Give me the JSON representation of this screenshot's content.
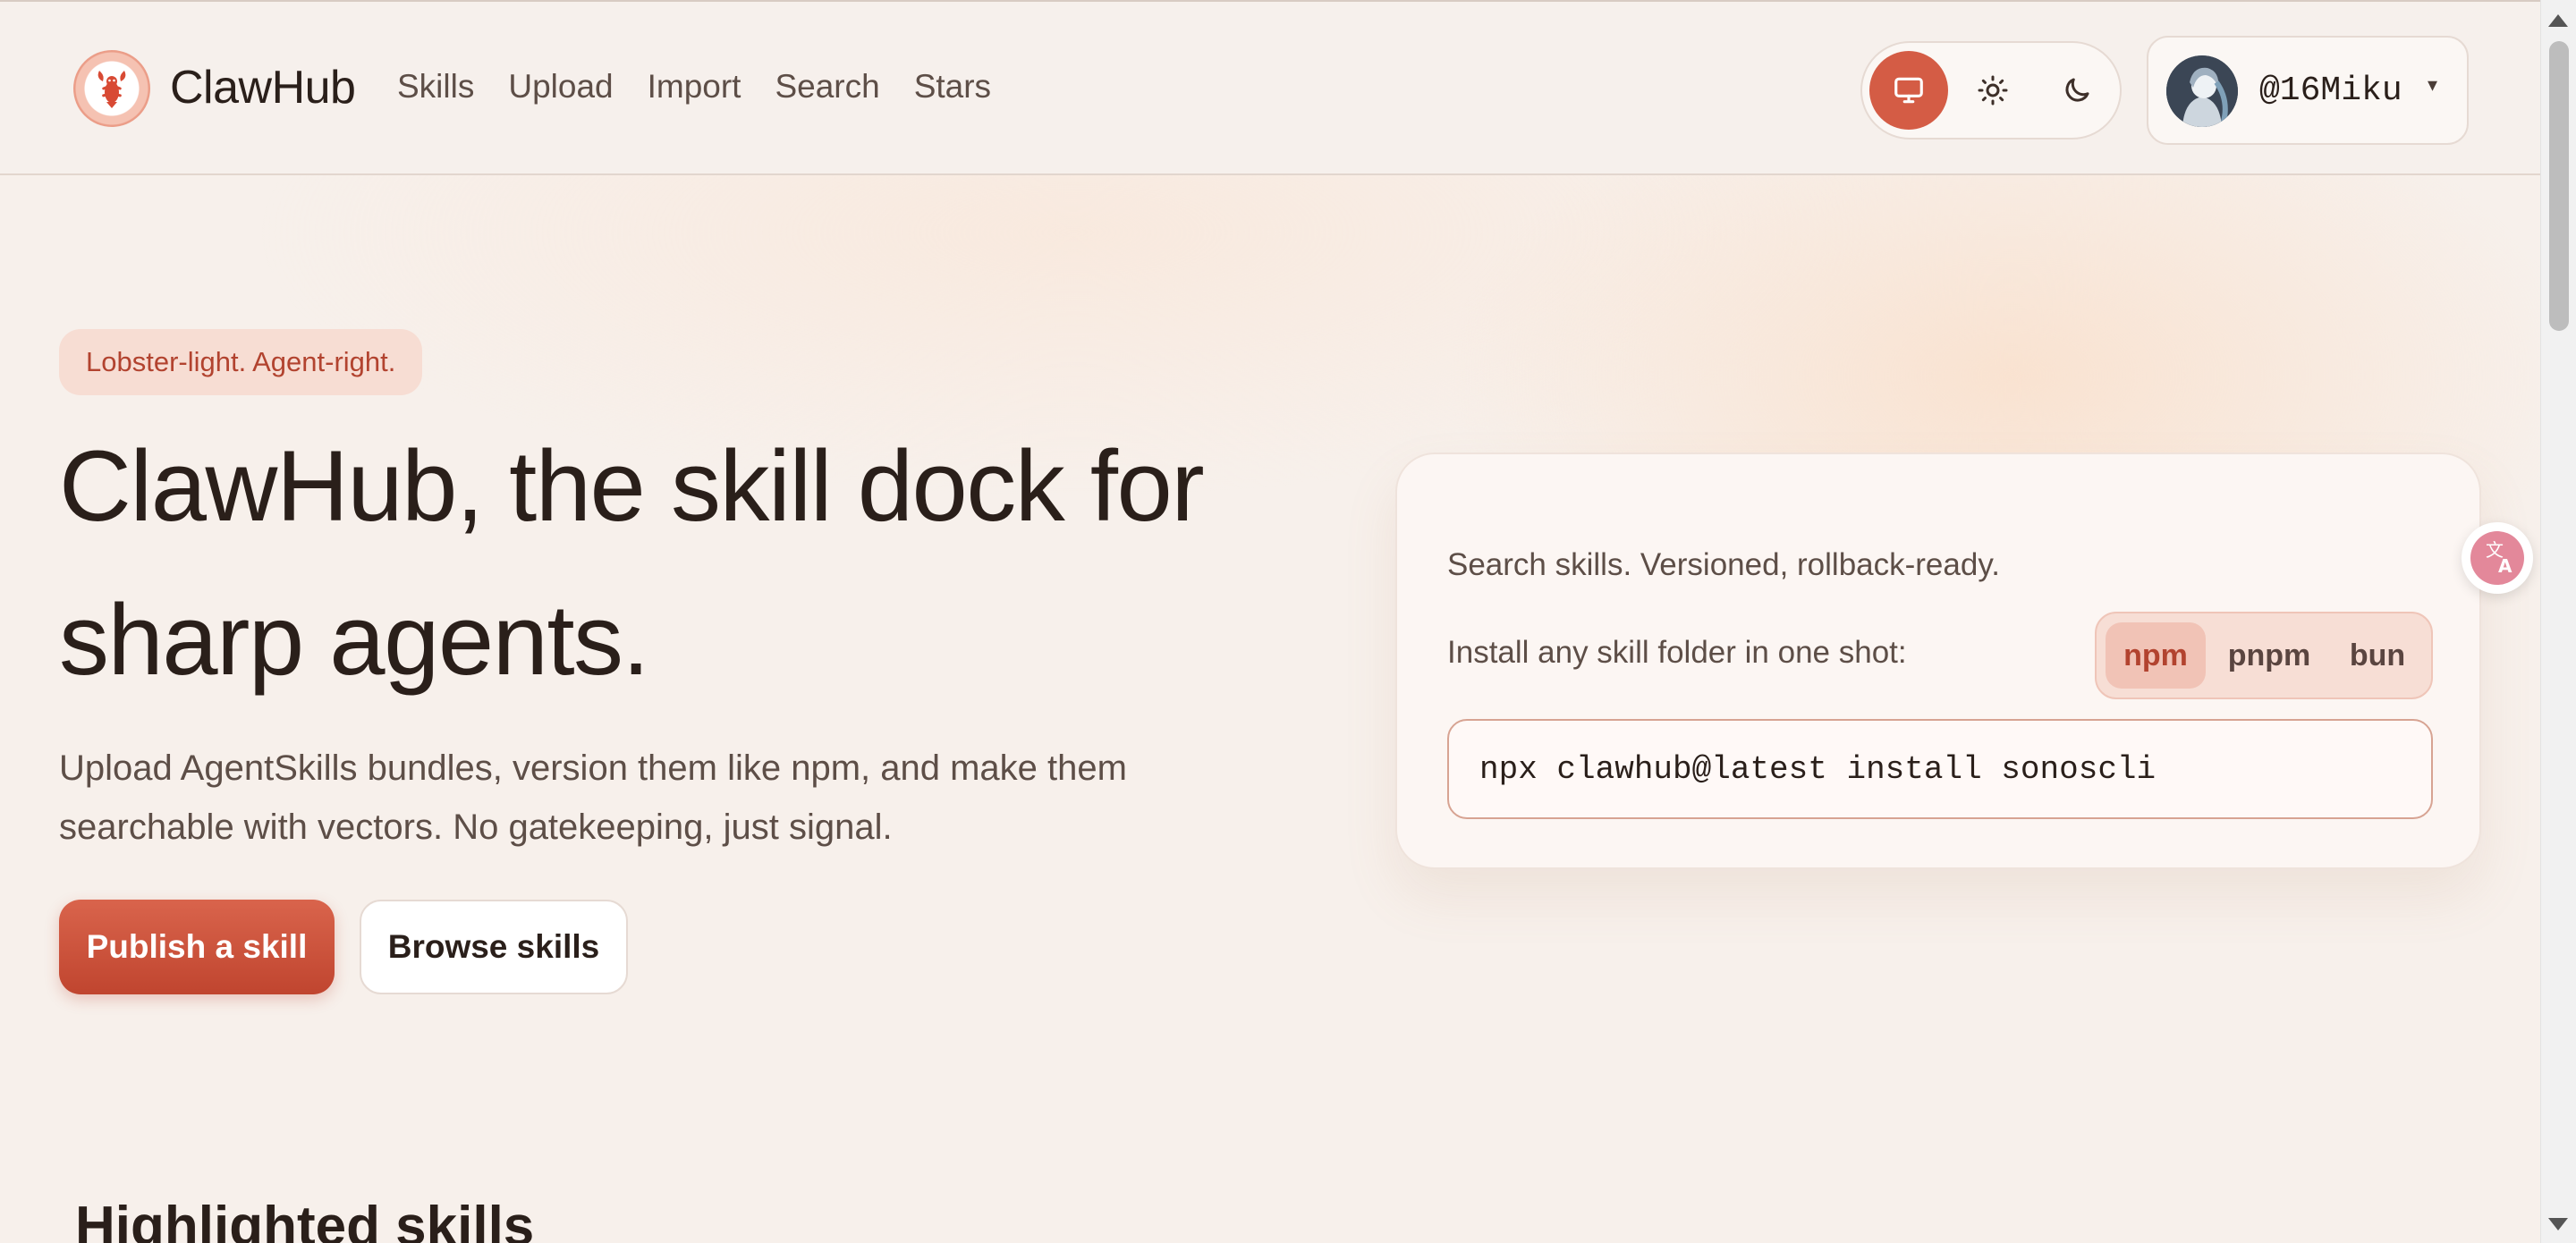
{
  "header": {
    "brand": "ClawHub",
    "nav": [
      "Skills",
      "Upload",
      "Import",
      "Search",
      "Stars"
    ],
    "theme_options": [
      "system",
      "light",
      "dark"
    ],
    "theme_active": "system",
    "user_handle": "@16Miku",
    "user_menu_caret": "▾"
  },
  "hero": {
    "badge": "Lobster-light. Agent-right.",
    "title": "ClawHub, the skill dock for sharp agents.",
    "subtitle": "Upload AgentSkills bundles, version them like npm, and make them searchable with vectors. No gatekeeping, just signal.",
    "primary_button": "Publish a skill",
    "secondary_button": "Browse skills"
  },
  "card": {
    "tagline": "Search skills. Versioned, rollback-ready.",
    "install_label": "Install any skill folder in one shot:",
    "package_managers": [
      "npm",
      "pnpm",
      "bun"
    ],
    "selected_package_manager": "npm",
    "command": "npx clawhub@latest install sonoscli"
  },
  "sections": {
    "highlighted_title": "Highlighted skills"
  },
  "colors": {
    "accent": "#d45c45",
    "accent_dark": "#b2432f",
    "background": "#f7f0eb",
    "text": "#2a1f1a"
  }
}
